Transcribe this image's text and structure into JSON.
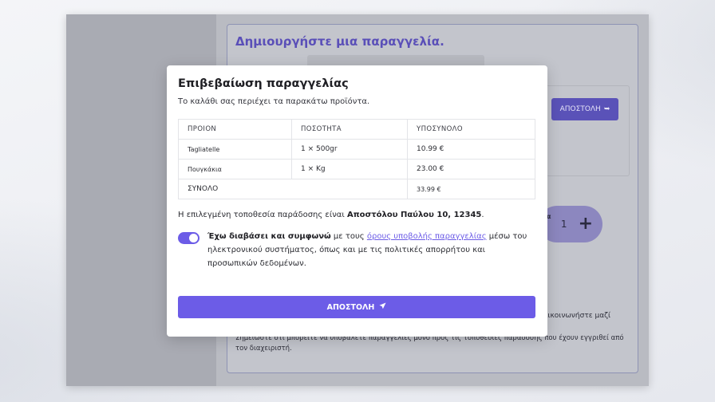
{
  "background_app": {
    "title": "Δημιουργήστε μια παραγγελία.",
    "send_button": "ΑΠΟΣΤΟΛΗ",
    "stepper": {
      "label_fragment": "α",
      "quantity": "1",
      "plus": "+"
    },
    "contact_fragment": "πικοινωνήστε μαζί",
    "note": "Σημειώστε ότι μπορείτε να υποβάλετε παραγγελίες μόνο προς τις τοποθεσίες παράδοσης που έχουν εγγριθεί από τον διαχειριστή."
  },
  "modal": {
    "title": "Επιβεβαίωση παραγγελίας",
    "subtitle": "Το καλάθι σας περιέχει τα παρακάτω προϊόντα.",
    "table": {
      "headers": [
        "ΠΡΟΙΟΝ",
        "ΠΟΣΟΤΗΤΑ",
        "ΥΠΟΣΥΝΟΛΟ"
      ],
      "rows": [
        {
          "product": "Tagliatelle",
          "quantity": "1 × 500gr",
          "subtotal": "10.99 €"
        },
        {
          "product": "Πουγκάκια",
          "quantity": "1 × Kg",
          "subtotal": "23.00 €"
        }
      ],
      "total_label": "ΣΥΝΟΛΟ",
      "total_value": "33.99 €"
    },
    "location_prefix": "Η επιλεγμένη τοποθεσία παράδοσης είναι ",
    "location_value": "Αποστόλου Παύλου 10, 12345",
    "location_suffix": ".",
    "consent": {
      "checked": true,
      "bold_text": "Έχω διαβάσει και συμφωνώ",
      "text_before_link": " με τους ",
      "link_text": "όρους υποβολής παραγγελίας",
      "text_after_link": " μέσω του ηλεκτρονικού συστήματος, όπως και με τις πολιτικές απορρήτου και προσωπικών δεδομένων."
    },
    "submit_label": "ΑΠΟΣΤΟΛΗ",
    "accent_color": "#6c5ce7"
  }
}
